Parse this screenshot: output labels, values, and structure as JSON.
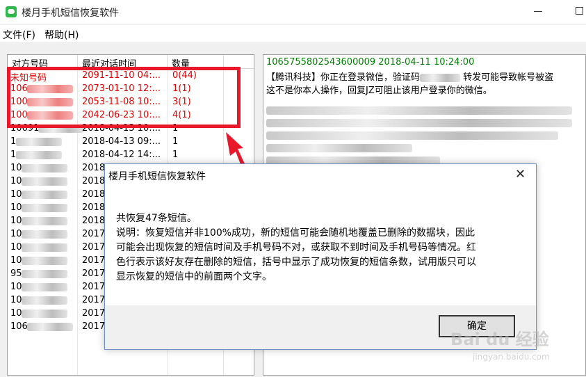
{
  "window": {
    "title": "楼月手机短信恢复软件"
  },
  "menu": [
    {
      "label": "文件(F)"
    },
    {
      "label": "帮助(H)"
    }
  ],
  "list": {
    "columns": [
      "对方号码",
      "最近对话时间",
      "数量"
    ],
    "rows": [
      {
        "number": "未知号码",
        "time": "2091-11-10 04:...",
        "count": "0(44)",
        "deleted": true,
        "blur": false
      },
      {
        "number": "106",
        "time": "2073-01-10 12:...",
        "count": "1(1)",
        "deleted": true,
        "blur": true
      },
      {
        "number": "100",
        "time": "2053-11-08 10:...",
        "count": "3(1)",
        "deleted": true,
        "blur": true
      },
      {
        "number": "100",
        "time": "2042-06-23 10:...",
        "count": "4(1)",
        "deleted": true,
        "blur": true
      },
      {
        "number": "10691",
        "time": "2018-04-13 10:...",
        "count": "1",
        "deleted": false,
        "blur": true
      },
      {
        "number": "1",
        "time": "2018-04-13 09:...",
        "count": "1",
        "deleted": false,
        "blur": true
      },
      {
        "number": "1",
        "time": "2018-04-12 14:...",
        "count": "1",
        "deleted": false,
        "blur": true
      },
      {
        "number": "10",
        "time": "2018",
        "count": "",
        "deleted": false,
        "blur": true
      },
      {
        "number": "10",
        "time": "2018",
        "count": "",
        "deleted": false,
        "blur": true
      },
      {
        "number": "10",
        "time": "2018",
        "count": "",
        "deleted": false,
        "blur": true
      },
      {
        "number": "10",
        "time": "2018",
        "count": "",
        "deleted": false,
        "blur": true
      },
      {
        "number": "10",
        "time": "2018",
        "count": "",
        "deleted": false,
        "blur": true
      },
      {
        "number": "10",
        "time": "2017",
        "count": "",
        "deleted": false,
        "blur": true
      },
      {
        "number": "10",
        "time": "2017",
        "count": "",
        "deleted": false,
        "blur": true
      },
      {
        "number": "10",
        "time": "2017",
        "count": "",
        "deleted": false,
        "blur": true
      },
      {
        "number": "95",
        "time": "2017",
        "count": "",
        "deleted": false,
        "blur": true
      },
      {
        "number": "10",
        "time": "2017",
        "count": "",
        "deleted": false,
        "blur": true
      },
      {
        "number": "10",
        "time": "2017",
        "count": "",
        "deleted": false,
        "blur": true
      },
      {
        "number": "10",
        "time": "2017",
        "count": "",
        "deleted": false,
        "blur": true
      },
      {
        "number": "106",
        "time": "2017",
        "count": "",
        "deleted": false,
        "blur": true
      }
    ]
  },
  "message": {
    "header": "1065755802543600009 2018-04-11 10:24:00",
    "line1_a": "【腾讯科技】你正在登录微信，验证码",
    "line1_b": "转发可能导致帐号被盗",
    "line2": "这不是你本人操作，回复JZ可阻止该用户登录你的微信。"
  },
  "dialog": {
    "title": "楼月手机短信恢复软件",
    "summary": "共恢复47条短信。",
    "note_lines": [
      "说明：恢复短信并非100%成功，新的短信可能会随机地覆盖已删除的数据块，因此",
      "可能会出现恢复的短信时间及手机号码不对，或获取不到时间及手机号码等情况。红",
      "色行表示该好友存在删除的短信，括号中显示了成功恢复的短信条数，试用版只可以",
      "显示恢复的短信中的前面两个文字。"
    ],
    "ok_label": "确定"
  },
  "watermark": {
    "brand": "Bai du 经验",
    "url": "jingyan.baidu.com"
  },
  "colors": {
    "deleted_row": "#e00000",
    "highlight_box": "#e8182a",
    "message_header": "#008000"
  }
}
